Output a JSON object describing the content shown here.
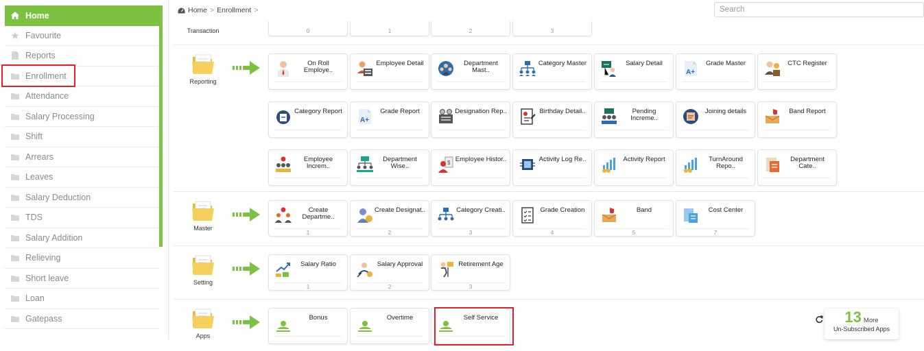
{
  "sidebar": {
    "items": [
      {
        "label": "Home",
        "icon": "home-icon"
      },
      {
        "label": "Favourite",
        "icon": "star-icon"
      },
      {
        "label": "Reports",
        "icon": "file-icon"
      },
      {
        "label": "Enrollment",
        "icon": "folder-icon"
      },
      {
        "label": "Attendance",
        "icon": "folder-icon"
      },
      {
        "label": "Salary Processing",
        "icon": "folder-icon"
      },
      {
        "label": "Shift",
        "icon": "folder-icon"
      },
      {
        "label": "Arrears",
        "icon": "folder-icon"
      },
      {
        "label": "Leaves",
        "icon": "folder-icon"
      },
      {
        "label": "Salary Deduction",
        "icon": "folder-icon"
      },
      {
        "label": "TDS",
        "icon": "folder-icon"
      },
      {
        "label": "Salary Addition",
        "icon": "folder-icon"
      },
      {
        "label": "Relieving",
        "icon": "folder-icon"
      },
      {
        "label": "Short leave",
        "icon": "folder-icon"
      },
      {
        "label": "Loan",
        "icon": "folder-icon"
      },
      {
        "label": "Gatepass",
        "icon": "folder-icon"
      }
    ]
  },
  "header": {
    "breadcrumb": {
      "home": "Home",
      "current": "Enrollment",
      "separator": ">"
    },
    "search_placeholder": "Search"
  },
  "sections": {
    "transaction": {
      "label": "Transaction",
      "counts": [
        "0",
        "1",
        "2",
        "3"
      ]
    },
    "reporting": {
      "label": "Reporting",
      "tiles": [
        {
          "title": "On Roll Employe..",
          "icon": "person-tie-icon"
        },
        {
          "title": "Employee Detail",
          "icon": "employee-card-icon"
        },
        {
          "title": "Department Mast..",
          "icon": "department-group-icon"
        },
        {
          "title": "Category Master",
          "icon": "category-tree-icon"
        },
        {
          "title": "Salary Detail",
          "icon": "salary-screen-icon"
        },
        {
          "title": "Grade Master",
          "icon": "grade-a-plus-icon"
        },
        {
          "title": "CTC Register",
          "icon": "ctc-register-icon"
        },
        {
          "title": "Category Report",
          "icon": "category-report-icon"
        },
        {
          "title": "Grade Report",
          "icon": "grade-a-plus-icon"
        },
        {
          "title": "Designation Rep..",
          "icon": "designation-icon"
        },
        {
          "title": "Birthday Detail..",
          "icon": "birthday-doc-icon"
        },
        {
          "title": "Pending Increme..",
          "icon": "pending-increment-icon"
        },
        {
          "title": "Joining details",
          "icon": "joining-icon"
        },
        {
          "title": "Band Report",
          "icon": "band-report-icon"
        },
        {
          "title": "Employee Increm..",
          "icon": "employee-increment-icon"
        },
        {
          "title": "Department Wise..",
          "icon": "department-wise-icon"
        },
        {
          "title": "Employee Histor..",
          "icon": "employee-history-icon"
        },
        {
          "title": "Activity Log Re..",
          "icon": "activity-log-icon"
        },
        {
          "title": "Activity Report",
          "icon": "activity-chart-icon"
        },
        {
          "title": "TurnAround Repo..",
          "icon": "turnaround-chart-icon"
        },
        {
          "title": "Department Cate..",
          "icon": "department-category-icon"
        }
      ]
    },
    "master": {
      "label": "Master",
      "tiles": [
        {
          "title": "Create Departme..",
          "count": "1",
          "icon": "create-department-icon"
        },
        {
          "title": "Create Designat..",
          "count": "2",
          "icon": "create-designation-icon"
        },
        {
          "title": "Category Creati..",
          "count": "3",
          "icon": "category-tree-icon"
        },
        {
          "title": "Grade Creation",
          "count": "4",
          "icon": "checklist-icon"
        },
        {
          "title": "Band",
          "count": "5",
          "icon": "band-icon"
        },
        {
          "title": "Cost Center",
          "count": "7",
          "icon": "cost-center-icon"
        }
      ]
    },
    "setting": {
      "label": "Setting",
      "tiles": [
        {
          "title": "Salary Ratio",
          "count": "1",
          "icon": "salary-ratio-icon"
        },
        {
          "title": "Salary Approval",
          "count": "2",
          "icon": "salary-approval-icon"
        },
        {
          "title": "Retirement Age",
          "count": "3",
          "icon": "retirement-age-icon"
        }
      ]
    },
    "apps": {
      "label": "Apps",
      "tiles": [
        {
          "title": "Bonus",
          "icon": "app-user-icon"
        },
        {
          "title": "Overtime",
          "icon": "app-user-icon"
        },
        {
          "title": "Self Service",
          "icon": "app-user-icon"
        }
      ]
    }
  },
  "more_apps": {
    "count": "13",
    "word": "More",
    "subtitle": "Un-Subscribed Apps"
  },
  "colors": {
    "accent": "#7cc142",
    "highlight": "#e01f26"
  }
}
